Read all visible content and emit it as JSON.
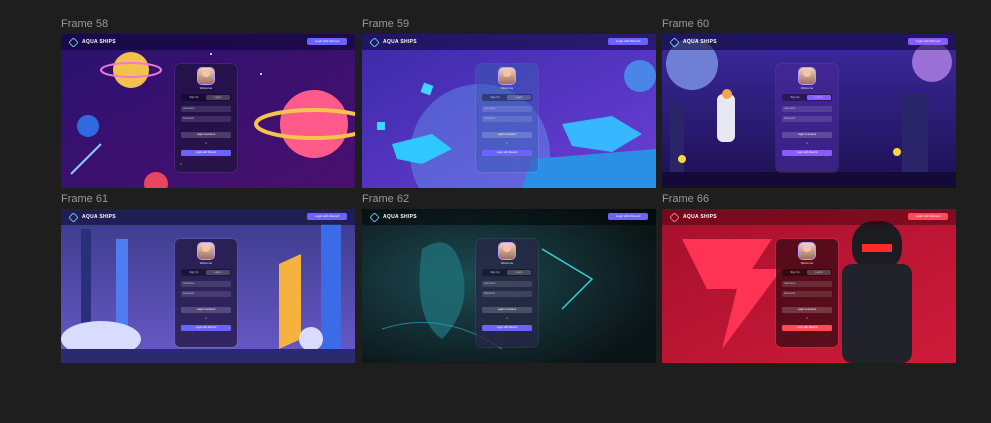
{
  "frames": [
    {
      "label": "Frame 58",
      "brand": "AQUA SHIPS",
      "top_button": "Login with Discord",
      "card_title": "Welcome",
      "tab_sign": "Sign Up",
      "tab_log": "Log In",
      "field1": "Username",
      "field2": "Password",
      "main_button": "Login to account",
      "or": "or",
      "alt_button": "Login with Discord",
      "accent": "#6c63ff",
      "theme": "purple-space"
    },
    {
      "label": "Frame 59",
      "brand": "AQUA SHIPS",
      "top_button": "Login with Discord",
      "card_title": "Welcome",
      "tab_sign": "Sign Up",
      "tab_log": "Log In",
      "field1": "Username",
      "field2": "Password",
      "main_button": "Login to account",
      "or": "or",
      "alt_button": "Login with Discord",
      "accent": "#6c63ff",
      "theme": "blue-islands"
    },
    {
      "label": "Frame 60",
      "brand": "AQUA SHIPS",
      "top_button": "Login with Discord",
      "card_title": "Welcome",
      "tab_sign": "Sign Up",
      "tab_log": "Log In",
      "field1": "Username",
      "field2": "Password",
      "main_button": "Login to account",
      "or": "or",
      "alt_button": "Login with Discord",
      "accent": "#8a5cff",
      "theme": "alien-planet"
    },
    {
      "label": "Frame 61",
      "brand": "AQUA SHIPS",
      "top_button": "Login with Discord",
      "card_title": "Welcome",
      "tab_sign": "Sign Up",
      "tab_log": "Log In",
      "field1": "Username",
      "field2": "Password",
      "main_button": "Login to account",
      "or": "or",
      "alt_button": "Login with Discord",
      "accent": "#6c63ff",
      "theme": "sci-fi-city"
    },
    {
      "label": "Frame 62",
      "brand": "AQUA SHIPS",
      "top_button": "Login with Discord",
      "card_title": "Welcome",
      "tab_sign": "Sign Up",
      "tab_log": "Log In",
      "field1": "Username",
      "field2": "Password",
      "main_button": "Login to account",
      "or": "or",
      "alt_button": "Login with Discord",
      "accent": "#6c63ff",
      "theme": "dark-teal"
    },
    {
      "label": "Frame 66",
      "brand": "AQUA SHIPS",
      "top_button": "Login with Discord",
      "card_title": "Welcome",
      "tab_sign": "Sign Up",
      "tab_log": "Log In",
      "field1": "Username",
      "field2": "Password",
      "main_button": "Login to account",
      "or": "or",
      "alt_button": "Login with Discord",
      "accent": "#ff4a5a",
      "theme": "red-hero"
    }
  ]
}
